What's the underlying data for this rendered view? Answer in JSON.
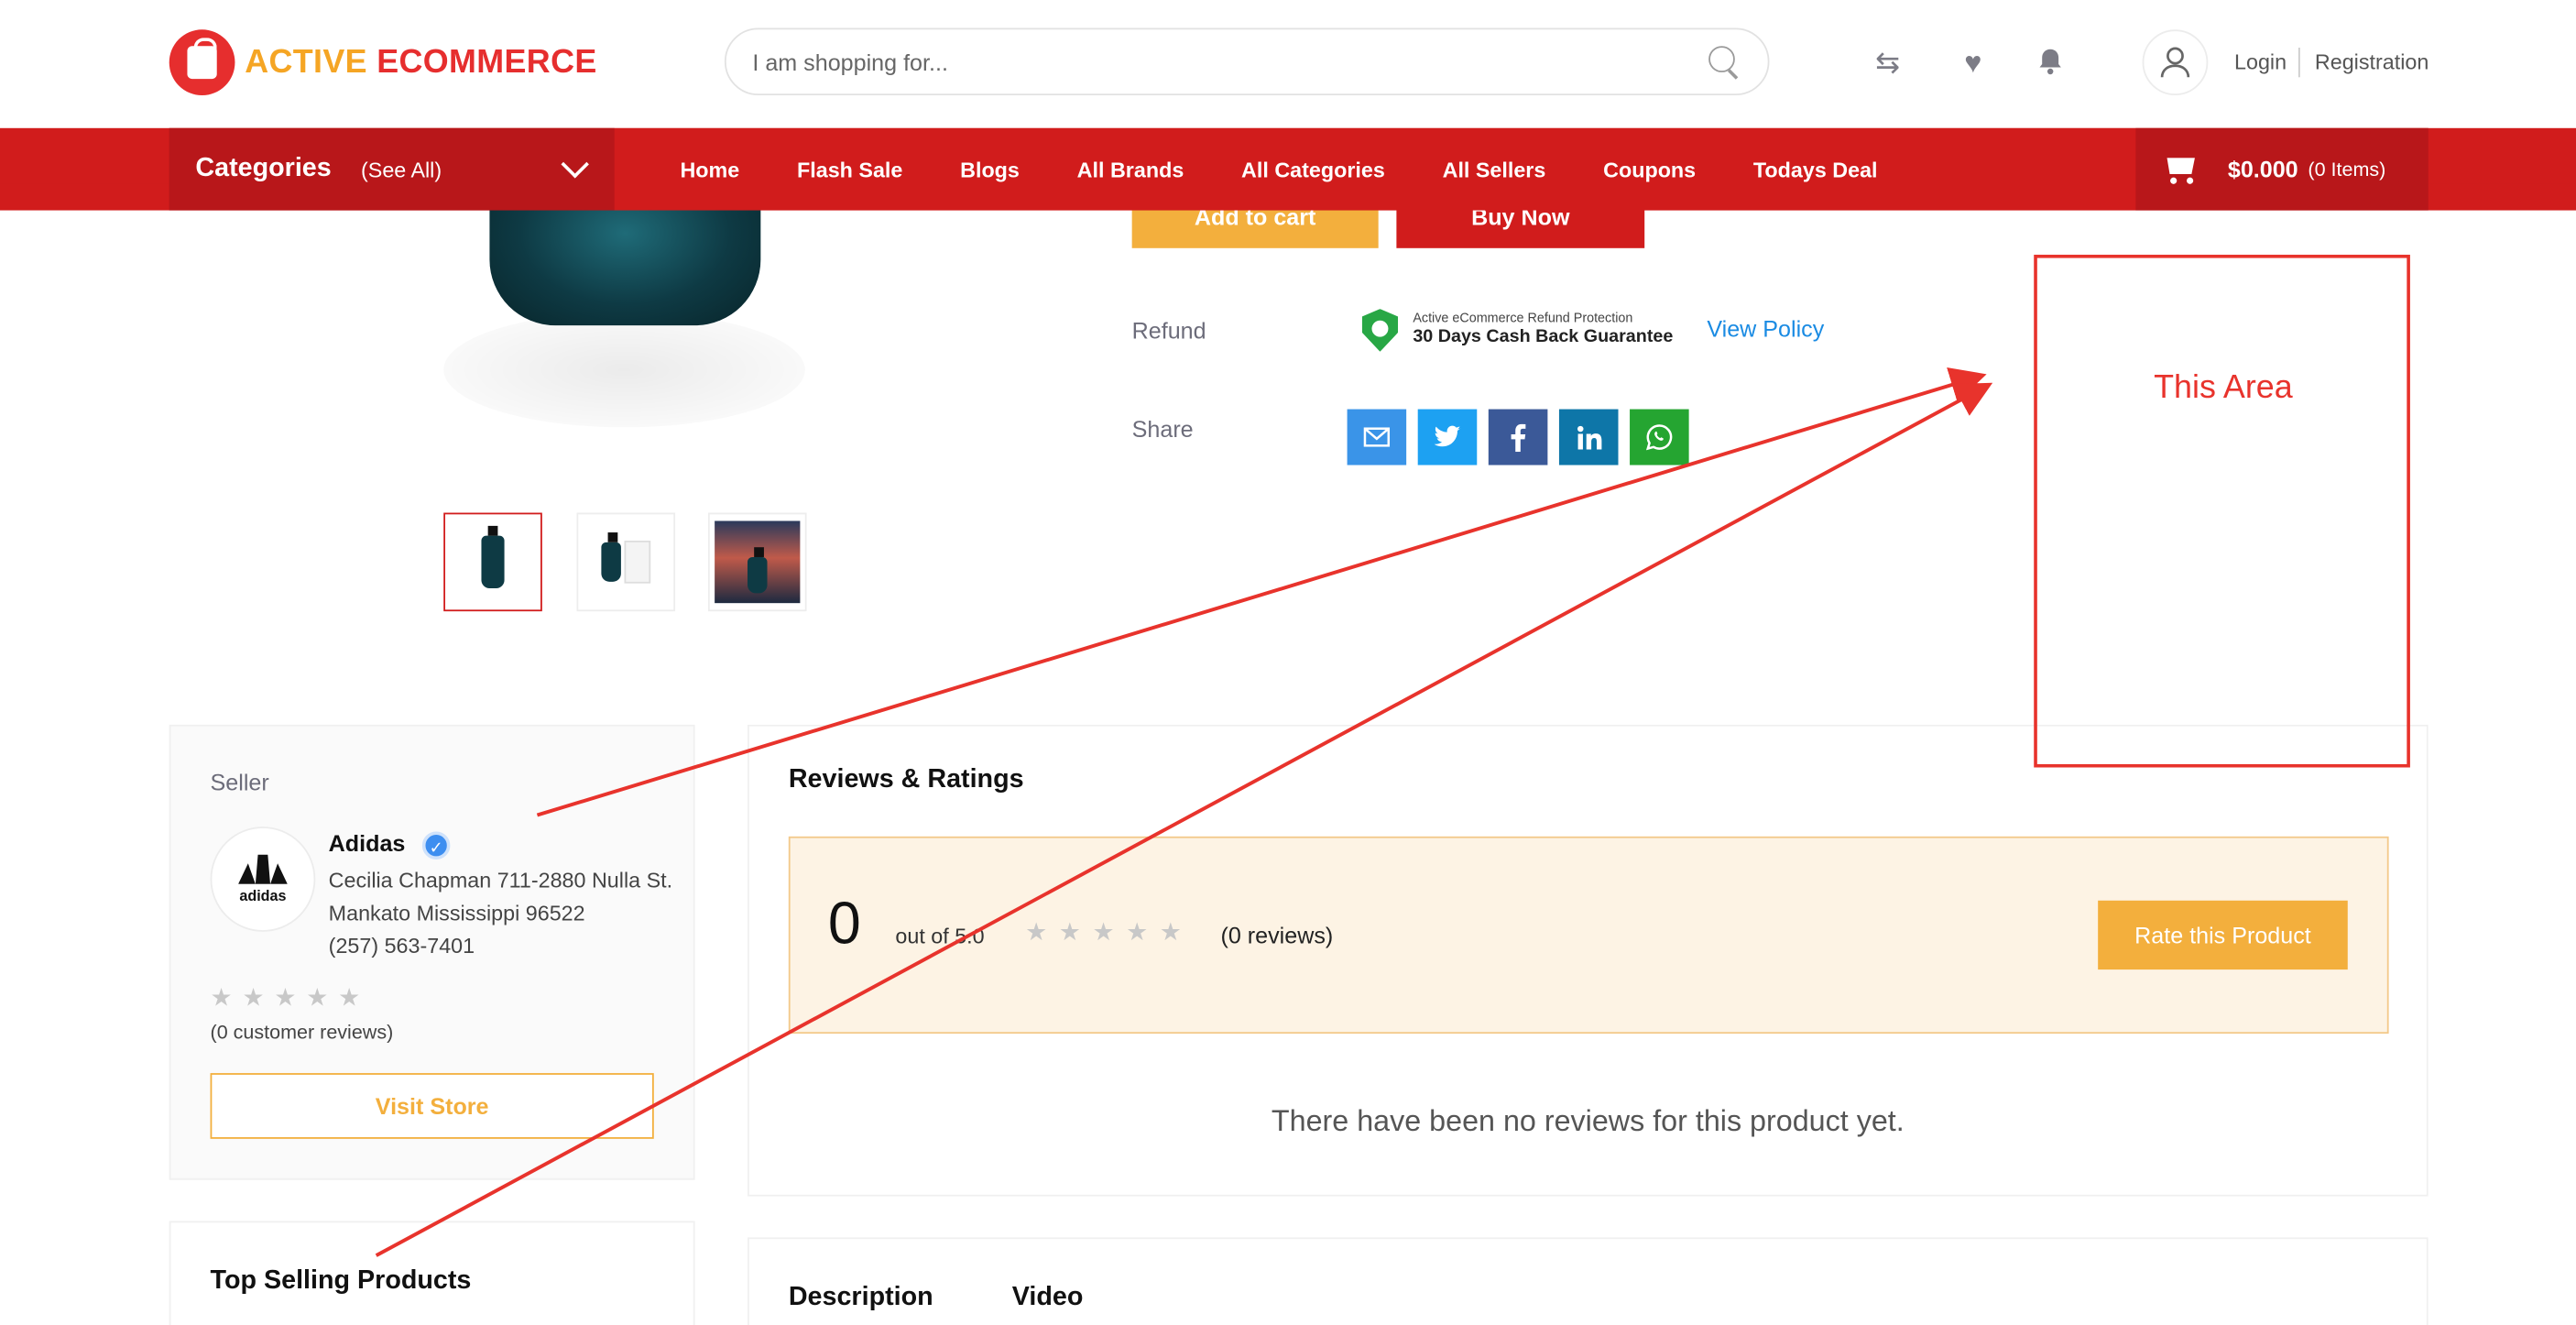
{
  "header": {
    "logo": {
      "word1": "ACTIVE",
      "word2": "ECOMMERCE"
    },
    "search": {
      "placeholder": "I am shopping for..."
    },
    "auth": {
      "login": "Login",
      "registration": "Registration"
    }
  },
  "nav": {
    "categories_title": "Categories",
    "categories_see_all": "(See All)",
    "links": [
      "Home",
      "Flash Sale",
      "Blogs",
      "All Brands",
      "All Categories",
      "All Sellers",
      "Coupons",
      "Todays Deal"
    ],
    "cart": {
      "amount": "$0.000",
      "items": "(0 Items)"
    }
  },
  "product": {
    "add_to_cart": "Add to cart",
    "buy_now": "Buy Now",
    "refund_label": "Refund",
    "refund_small": "Active eCommerce Refund Protection",
    "refund_big": "30 Days Cash Back Guarantee",
    "view_policy": "View Policy",
    "share_label": "Share"
  },
  "annotation": {
    "text": "This Area",
    "color": "#e8332c"
  },
  "seller": {
    "label": "Seller",
    "name": "Adidas",
    "logo_word": "adidas",
    "address": "Cecilia Chapman 711-2880 Nulla St. Mankato Mississippi 96522",
    "phone": "(257) 563-7401",
    "rating": 0,
    "reviews": "(0 customer reviews)",
    "visit_store": "Visit Store"
  },
  "top_selling": {
    "title": "Top Selling Products"
  },
  "reviews": {
    "title": "Reviews & Ratings",
    "score": "0",
    "out_of": "out of 5.0",
    "count": "(0 reviews)",
    "rate_button": "Rate this Product",
    "empty": "There have been no reviews for this product yet."
  },
  "tabs": {
    "description": "Description",
    "video": "Video"
  },
  "colors": {
    "brand_red": "#d11c1c",
    "accent_orange": "#f3af3d",
    "link_blue": "#1a8be3"
  }
}
